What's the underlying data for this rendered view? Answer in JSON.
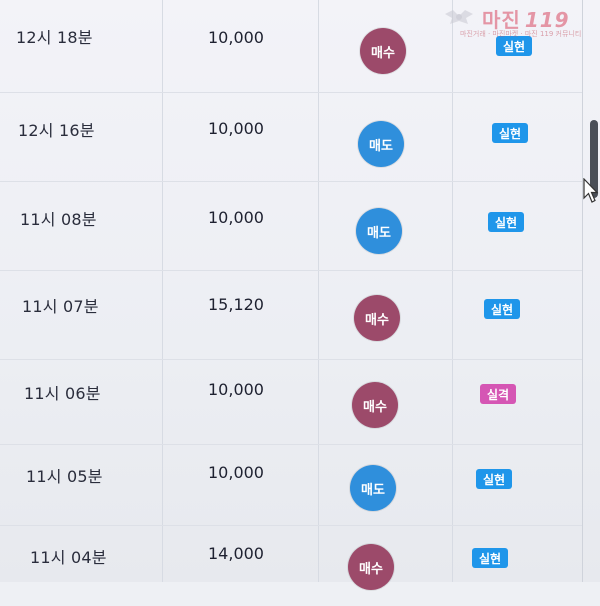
{
  "watermark": {
    "brand": "마진",
    "brand_suffix": "119",
    "tagline": "마진거래 · 마진마켓 · 마진 119 커뮤니티"
  },
  "trades": [
    {
      "time": "12시 18분",
      "amount": "10,000",
      "action": "매수",
      "action_type": "buy",
      "result": "실현",
      "result_type": "good"
    },
    {
      "time": "12시 16분",
      "amount": "10,000",
      "action": "매도",
      "action_type": "sell",
      "result": "실현",
      "result_type": "good"
    },
    {
      "time": "11시 08분",
      "amount": "10,000",
      "action": "매도",
      "action_type": "sell",
      "result": "실현",
      "result_type": "good"
    },
    {
      "time": "11시 07분",
      "amount": "15,120",
      "action": "매수",
      "action_type": "buy",
      "result": "실현",
      "result_type": "good"
    },
    {
      "time": "11시 06분",
      "amount": "10,000",
      "action": "매수",
      "action_type": "buy",
      "result": "실격",
      "result_type": "bad"
    },
    {
      "time": "11시 05분",
      "amount": "10,000",
      "action": "매도",
      "action_type": "sell",
      "result": "실현",
      "result_type": "good"
    },
    {
      "time": "11시 04분",
      "amount": "14,000",
      "action": "매수",
      "action_type": "buy",
      "result": "실현",
      "result_type": "good"
    }
  ],
  "colors": {
    "buy": "#9c4a6a",
    "sell": "#2f8fdc",
    "realized": "#1f96ea",
    "failed": "#d556b4"
  }
}
